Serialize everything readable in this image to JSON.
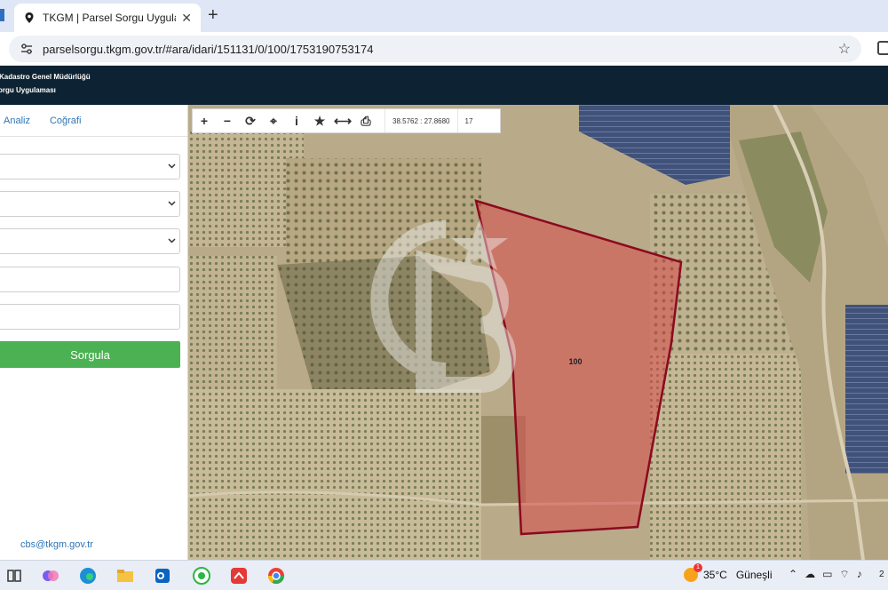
{
  "browser": {
    "tab_title": "TKGM | Parsel Sorgu Uygulama",
    "new_tab_label": "+",
    "close_label": "✕",
    "url": "parselsorgu.tkgm.gov.tr/#ara/idari/151131/0/100/1753190753174"
  },
  "app": {
    "header_line1": "Kadastro Genel Müdürlüğü",
    "header_line2": "orgu Uygulaması"
  },
  "sidebar": {
    "tabs": [
      "Analiz",
      "Coğrafi"
    ],
    "search_button": "Sorgula",
    "contact_email": "cbs@tkgm.gov.tr"
  },
  "map": {
    "coordinates": "38.5762 : 27.8680",
    "zoom_level": "17",
    "parcel_label": "100",
    "parcel_fill_color": "#d94a4a",
    "parcel_stroke_color": "#8b0a1e",
    "tools": [
      "plus-icon",
      "minus-icon",
      "refresh-icon",
      "locate-icon",
      "info-icon",
      "star-icon",
      "measure-icon",
      "print-icon"
    ],
    "tool_glyphs": [
      "+",
      "−",
      "⟳",
      "⌖",
      "i",
      "★",
      "⟷",
      "⎙"
    ]
  },
  "taskbar": {
    "temperature": "35°C",
    "weather_condition": "Güneşli",
    "clock_partial": "2"
  }
}
